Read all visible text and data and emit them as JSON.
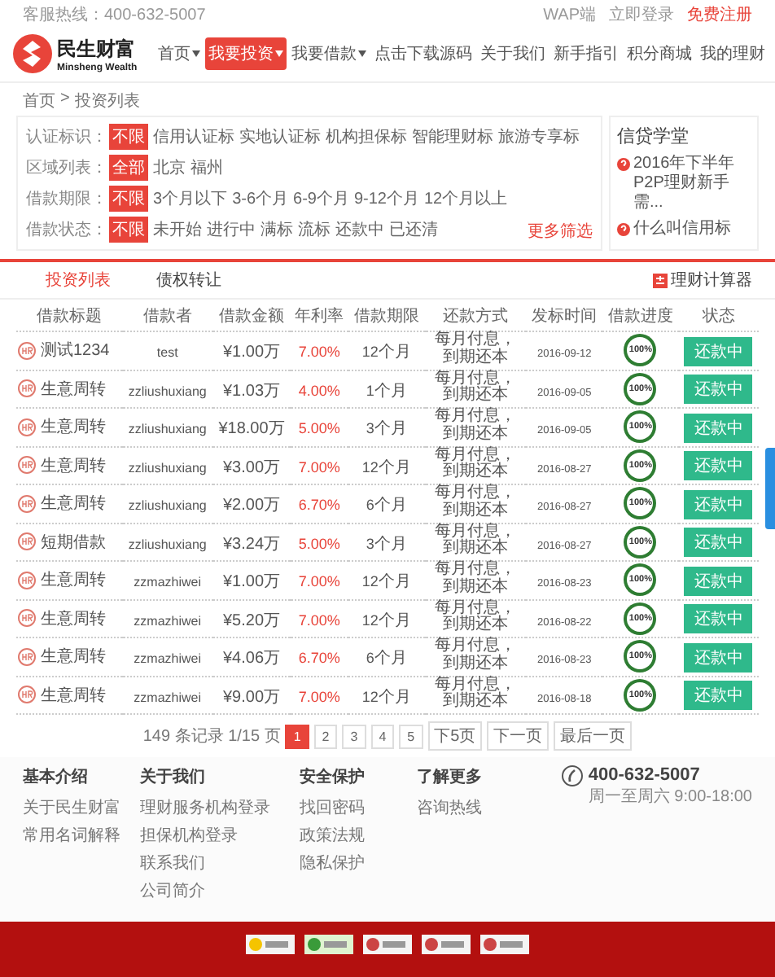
{
  "top_bar": {
    "hotline": "客服热线：400-632-5007",
    "links": [
      {
        "label": "WAP端",
        "kind": "plain"
      },
      {
        "label": "立即登录",
        "kind": "plain"
      },
      {
        "label": "免费注册",
        "kind": "accent"
      }
    ]
  },
  "logo": {
    "name": "民生财富",
    "subtitle": "Minsheng Wealth"
  },
  "nav": [
    {
      "label": "首页",
      "dropdown": true,
      "selected": false
    },
    {
      "label": "我要投资",
      "dropdown": true,
      "selected": true
    },
    {
      "label": "我要借款",
      "dropdown": true,
      "selected": false
    },
    {
      "label": "点击下载源码",
      "dropdown": false,
      "selected": false
    },
    {
      "label": "关于我们",
      "dropdown": false,
      "selected": false
    },
    {
      "label": "新手指引",
      "dropdown": false,
      "selected": false
    },
    {
      "label": "积分商城",
      "dropdown": false,
      "selected": false
    },
    {
      "label": "我的理财",
      "dropdown": false,
      "selected": false
    }
  ],
  "breadcrumb": [
    "首页",
    "投资列表"
  ],
  "breadcrumb_separator": ">",
  "filters": [
    {
      "label": "认证标识：",
      "options": [
        {
          "label": "不限",
          "selected": true
        },
        {
          "label": "信用认证标",
          "selected": false
        },
        {
          "label": "实地认证标",
          "selected": false
        },
        {
          "label": "机构担保标",
          "selected": false
        },
        {
          "label": "智能理财标",
          "selected": false
        },
        {
          "label": "旅游专享标",
          "selected": false
        }
      ]
    },
    {
      "label": "区域列表：",
      "options": [
        {
          "label": "全部",
          "selected": true
        },
        {
          "label": "北京",
          "selected": false
        },
        {
          "label": "福州",
          "selected": false
        }
      ]
    },
    {
      "label": "借款期限：",
      "options": [
        {
          "label": "不限",
          "selected": true
        },
        {
          "label": "3个月以下",
          "selected": false
        },
        {
          "label": "3-6个月",
          "selected": false
        },
        {
          "label": "6-9个月",
          "selected": false
        },
        {
          "label": "9-12个月",
          "selected": false
        },
        {
          "label": "12个月以上",
          "selected": false
        }
      ]
    },
    {
      "label": "借款状态：",
      "options": [
        {
          "label": "不限",
          "selected": true
        },
        {
          "label": "未开始",
          "selected": false
        },
        {
          "label": "进行中",
          "selected": false
        },
        {
          "label": "满标",
          "selected": false
        },
        {
          "label": "流标",
          "selected": false
        },
        {
          "label": "还款中",
          "selected": false
        },
        {
          "label": "已还清",
          "selected": false
        }
      ]
    }
  ],
  "more_filters": "更多筛选",
  "school": {
    "title": "信贷学堂",
    "items": [
      "2016年下半年P2P理财新手需...",
      "什么叫信用标"
    ]
  },
  "tabs": [
    {
      "label": "投资列表",
      "selected": true
    },
    {
      "label": "债权转让",
      "selected": false
    }
  ],
  "calculator": "理财计算器",
  "table": {
    "columns": [
      "借款标题",
      "借款者",
      "借款金额",
      "年利率",
      "借款期限",
      "还款方式",
      "发标时间",
      "借款进度",
      "状态"
    ],
    "rows": [
      {
        "title": "测试1234",
        "user": "test",
        "amount": "¥1.00万",
        "rate": "7.00%",
        "term": "12",
        "unit": "个月",
        "method": "每月付息，到期还本",
        "date": "2016-09-12",
        "progress": "100%",
        "level": 1,
        "status": "还款中"
      },
      {
        "title": "生意周转",
        "user": "zzliushuxiang",
        "amount": "¥1.03万",
        "rate": "4.00%",
        "term": "1",
        "unit": "个月",
        "method": "每月付息，到期还本",
        "date": "2016-09-05",
        "progress": "100%",
        "level": 1,
        "status": "还款中"
      },
      {
        "title": "生意周转",
        "user": "zzliushuxiang",
        "amount": "¥18.00万",
        "rate": "5.00%",
        "term": "3",
        "unit": "个月",
        "method": "每月付息，到期还本",
        "date": "2016-09-05",
        "progress": "100%",
        "level": 1,
        "status": "还款中"
      },
      {
        "title": "生意周转",
        "user": "zzliushuxiang",
        "amount": "¥3.00万",
        "rate": "7.00%",
        "term": "12",
        "unit": "个月",
        "method": "每月付息，到期还本",
        "date": "2016-08-27",
        "progress": "100%",
        "level": 1,
        "status": "还款中"
      },
      {
        "title": "生意周转",
        "user": "zzliushuxiang",
        "amount": "¥2.00万",
        "rate": "6.70%",
        "term": "6",
        "unit": "个月",
        "method": "每月付息，到期还本",
        "date": "2016-08-27",
        "progress": "100%",
        "level": 1,
        "status": "还款中"
      },
      {
        "title": "短期借款",
        "user": "zzliushuxiang",
        "amount": "¥3.24万",
        "rate": "5.00%",
        "term": "3",
        "unit": "个月",
        "method": "每月付息，到期还本",
        "date": "2016-08-27",
        "progress": "100%",
        "level": 1,
        "status": "还款中"
      },
      {
        "title": "生意周转",
        "user": "zzmazhiwei",
        "amount": "¥1.00万",
        "rate": "7.00%",
        "term": "12",
        "unit": "个月",
        "method": "每月付息，到期还本",
        "date": "2016-08-23",
        "progress": "100%",
        "level": 1,
        "status": "还款中"
      },
      {
        "title": "生意周转",
        "user": "zzmazhiwei",
        "amount": "¥5.20万",
        "rate": "7.00%",
        "term": "12",
        "unit": "个月",
        "method": "每月付息，到期还本",
        "date": "2016-08-22",
        "progress": "100%",
        "level": 1,
        "status": "还款中"
      },
      {
        "title": "生意周转",
        "user": "zzmazhiwei",
        "amount": "¥4.06万",
        "rate": "6.70%",
        "term": "6",
        "unit": "个月",
        "method": "每月付息，到期还本",
        "date": "2016-08-23",
        "progress": "100%",
        "level": 1,
        "status": "还款中"
      },
      {
        "title": "生意周转",
        "user": "zzmazhiwei",
        "amount": "¥9.00万",
        "rate": "7.00%",
        "term": "12",
        "unit": "个月",
        "method": "每月付息，到期还本",
        "date": "2016-08-18",
        "progress": "100%",
        "level": 1,
        "status": "还款中"
      }
    ]
  },
  "pagination": {
    "summary": "149 条记录 1/15 页",
    "pages": [
      {
        "label": "1",
        "selected": true
      },
      {
        "label": "2",
        "selected": false
      },
      {
        "label": "3",
        "selected": false
      },
      {
        "label": "4",
        "selected": false
      },
      {
        "label": "5",
        "selected": false
      }
    ],
    "links": [
      "下5页",
      "下一页",
      "最后一页"
    ]
  },
  "footer": {
    "columns": [
      {
        "title": "基本介绍",
        "links": [
          "关于民生财富",
          "常用名词解释"
        ]
      },
      {
        "title": "关于我们",
        "links": [
          "理财服务机构登录",
          "担保机构登录",
          "联系我们",
          "公司简介"
        ]
      },
      {
        "title": "安全保护",
        "links": [
          "找回密码",
          "政策法规",
          "隐私保护"
        ]
      },
      {
        "title": "了解更多",
        "links": [
          "咨询热线"
        ]
      }
    ],
    "phone": "400-632-5007",
    "hours": "周一至周六 9:00-18:00"
  }
}
